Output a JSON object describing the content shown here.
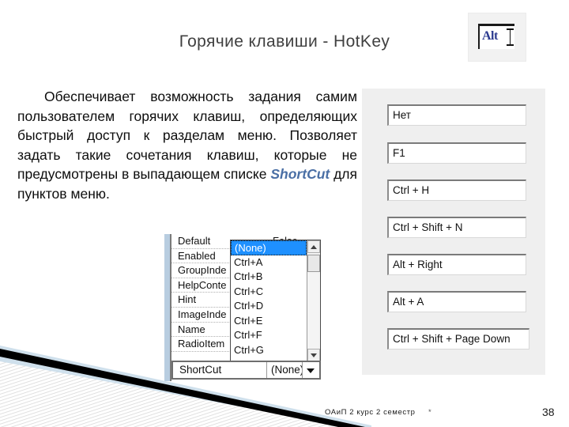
{
  "slide": {
    "title": "Горячие клавиши - HotKey",
    "logo": {
      "name": "alt-key-logo",
      "text": "Alt"
    },
    "body": {
      "paragraph_part1": "Обеспечивает возможность задания самим пользователем горячих клавиш, определяющих быстрый доступ к разделам меню. Позволяет задать такие сочетания клавиш, которые не предусмотрены в выпадающем списке ",
      "highlighted_term": "ShortCut",
      "paragraph_part2": " для пунктов меню."
    }
  },
  "hotkey_panel": {
    "fields": [
      {
        "value": "Нет"
      },
      {
        "value": "F1"
      },
      {
        "value": "Ctrl + H"
      },
      {
        "value": "Ctrl + Shift + N"
      },
      {
        "value": "Alt + Right"
      },
      {
        "value": "Alt + A"
      },
      {
        "value": "Ctrl + Shift + Page Down"
      }
    ]
  },
  "property_grid": {
    "rows": [
      {
        "name": "Default",
        "value": "False"
      },
      {
        "name": "Enabled",
        "value": ""
      },
      {
        "name": "GroupInde",
        "value": ""
      },
      {
        "name": "HelpConte",
        "value": ""
      },
      {
        "name": "Hint",
        "value": ""
      },
      {
        "name": "ImageInde",
        "value": ""
      },
      {
        "name": "Name",
        "value": ""
      },
      {
        "name": "RadioItem",
        "value": ""
      }
    ],
    "selected_row": {
      "name": "ShortCut",
      "value": "(None)"
    },
    "dropdown": {
      "options": [
        "(None)",
        "Ctrl+A",
        "Ctrl+B",
        "Ctrl+C",
        "Ctrl+D",
        "Ctrl+E",
        "Ctrl+F",
        "Ctrl+G"
      ],
      "selected_index": 0
    }
  },
  "footer": {
    "course": "ОАиП 2 курс 2 семестр",
    "marker": "*",
    "page_number": "38"
  },
  "colors": {
    "title": "#404040",
    "accent_term": "#4a6fa5",
    "panel_bg": "#efefef",
    "dropdown_selection": "#1e90ff",
    "deco_blue": "#cfe0ec",
    "deco_black": "#000000"
  }
}
